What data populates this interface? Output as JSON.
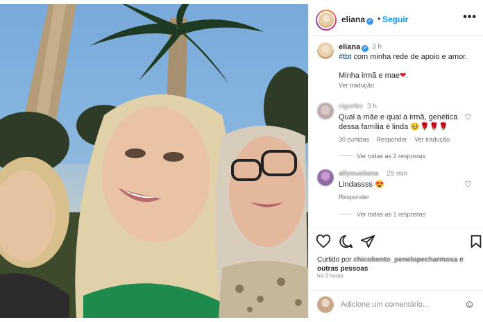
{
  "post": {
    "username": "eliana",
    "follow_label": "Seguir",
    "more_label": "•••",
    "dot": "•"
  },
  "caption": {
    "username": "eliana",
    "time": "3 h",
    "hashtag": "#tbt",
    "text_line1": "com minha rede de apoio e amor.",
    "text_line2": "Minha irmã e mae",
    "heart": "❤",
    "trailing": ".",
    "translate": "Ver tradução"
  },
  "comments": [
    {
      "username": "rigorbo",
      "time": "3 h",
      "text": "Qual a mãe e qual a irmã, genética dessa família é linda 🥹🌹🌹🌹",
      "likes": "30 curtidas",
      "reply": "Responder",
      "translate": "Ver tradução",
      "replies": "Ver todas as 2 respostas"
    },
    {
      "username": "allyoueliana",
      "time": "29 min",
      "text": "Lindassss 😍",
      "reply": "Responder",
      "replies": "Ver todas as 1 respostas"
    }
  ],
  "liked_by": {
    "prefix": "Curtido por",
    "users": "chicobento_penelopecharmosa",
    "suffix": "e",
    "others": "outras pessoas"
  },
  "posted_ago": "há 3 horas",
  "add_comment": {
    "placeholder": "Adicione um comentário..."
  },
  "icons": {
    "verified": "verified-badge-icon",
    "like": "heart-icon",
    "comment": "comment-icon",
    "share": "share-icon",
    "save": "bookmark-icon",
    "emoji": "emoji-icon"
  },
  "colors": {
    "link_blue": "#0095f6",
    "verified_blue": "#3897f0",
    "heart_red": "#e0152d",
    "muted": "#8e8e8e"
  }
}
